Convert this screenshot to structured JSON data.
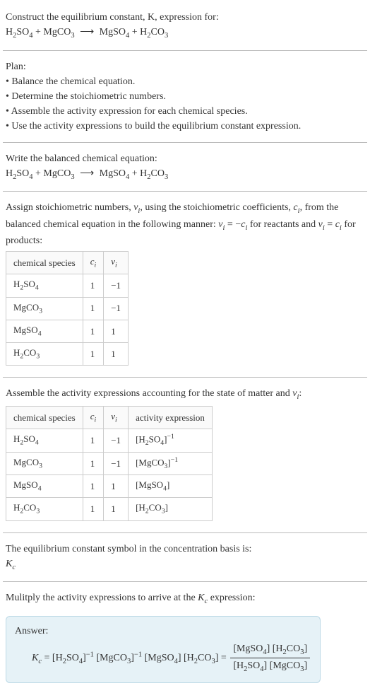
{
  "header": {
    "construct_line": "Construct the equilibrium constant, K, expression for:",
    "reaction_html": "H<sub>2</sub>SO<sub>4</sub> + MgCO<sub>3</sub> <span class='arrow'>⟶</span> MgSO<sub>4</sub> + H<sub>2</sub>CO<sub>3</sub>"
  },
  "plan": {
    "title": "Plan:",
    "items": [
      "• Balance the chemical equation.",
      "• Determine the stoichiometric numbers.",
      "• Assemble the activity expression for each chemical species.",
      "• Use the activity expressions to build the equilibrium constant expression."
    ]
  },
  "balanced": {
    "line": "Write the balanced chemical equation:",
    "reaction_html": "H<sub>2</sub>SO<sub>4</sub> + MgCO<sub>3</sub> <span class='arrow'>⟶</span> MgSO<sub>4</sub> + H<sub>2</sub>CO<sub>3</sub>"
  },
  "stoich": {
    "intro_html": "Assign stoichiometric numbers, <i>ν<sub>i</sub></i>, using the stoichiometric coefficients, <i>c<sub>i</sub></i>, from the balanced chemical equation in the following manner: <i>ν<sub>i</sub></i> = −<i>c<sub>i</sub></i> for reactants and <i>ν<sub>i</sub></i> = <i>c<sub>i</sub></i> for products:",
    "headers": {
      "species": "chemical species",
      "ci": "cᵢ",
      "vi": "νᵢ"
    },
    "rows": [
      {
        "species_html": "H<sub>2</sub>SO<sub>4</sub>",
        "ci": "1",
        "vi": "−1"
      },
      {
        "species_html": "MgCO<sub>3</sub>",
        "ci": "1",
        "vi": "−1"
      },
      {
        "species_html": "MgSO<sub>4</sub>",
        "ci": "1",
        "vi": "1"
      },
      {
        "species_html": "H<sub>2</sub>CO<sub>3</sub>",
        "ci": "1",
        "vi": "1"
      }
    ]
  },
  "activity": {
    "intro_html": "Assemble the activity expressions accounting for the state of matter and <i>ν<sub>i</sub></i>:",
    "headers": {
      "species": "chemical species",
      "ci": "cᵢ",
      "vi": "νᵢ",
      "expr": "activity expression"
    },
    "rows": [
      {
        "species_html": "H<sub>2</sub>SO<sub>4</sub>",
        "ci": "1",
        "vi": "−1",
        "expr_html": "[H<sub>2</sub>SO<sub>4</sub>]<sup>−1</sup>"
      },
      {
        "species_html": "MgCO<sub>3</sub>",
        "ci": "1",
        "vi": "−1",
        "expr_html": "[MgCO<sub>3</sub>]<sup>−1</sup>"
      },
      {
        "species_html": "MgSO<sub>4</sub>",
        "ci": "1",
        "vi": "1",
        "expr_html": "[MgSO<sub>4</sub>]"
      },
      {
        "species_html": "H<sub>2</sub>CO<sub>3</sub>",
        "ci": "1",
        "vi": "1",
        "expr_html": "[H<sub>2</sub>CO<sub>3</sub>]"
      }
    ]
  },
  "basis": {
    "line": "The equilibrium constant symbol in the concentration basis is:",
    "symbol_html": "<i>K<sub>c</sub></i>"
  },
  "multiply_line_html": "Mulitply the activity expressions to arrive at the <i>K<sub>c</sub></i> expression:",
  "answer": {
    "label": "Answer:",
    "lhs_html": "<i>K<sub>c</sub></i> = [H<sub>2</sub>SO<sub>4</sub>]<sup>−1</sup> [MgCO<sub>3</sub>]<sup>−1</sup> [MgSO<sub>4</sub>] [H<sub>2</sub>CO<sub>3</sub>] = ",
    "frac_num_html": "[MgSO<sub>4</sub>] [H<sub>2</sub>CO<sub>3</sub>]",
    "frac_den_html": "[H<sub>2</sub>SO<sub>4</sub>] [MgCO<sub>3</sub>]"
  }
}
